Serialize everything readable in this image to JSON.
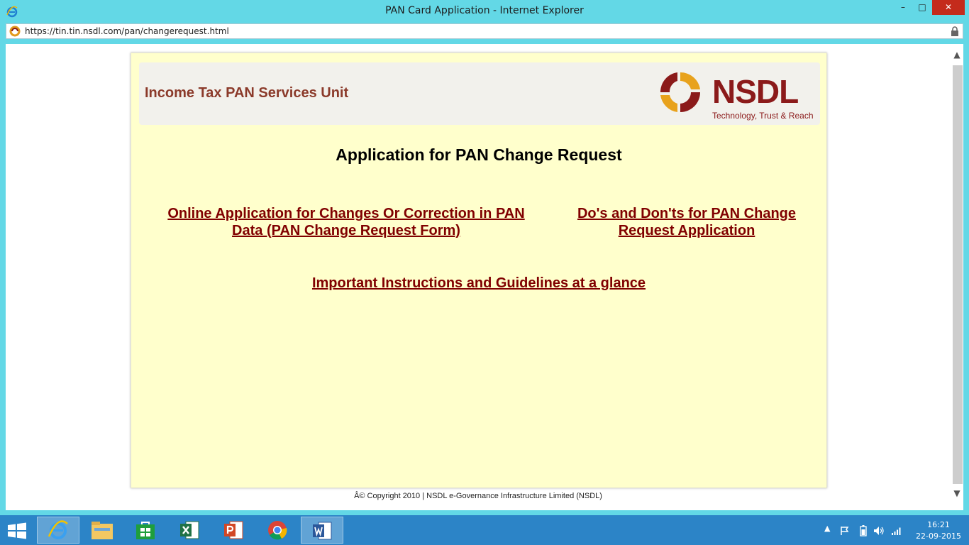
{
  "window": {
    "title": "PAN Card Application - Internet Explorer",
    "minimize_glyph": "–",
    "maximize_glyph": "□",
    "close_glyph": "✕"
  },
  "address": {
    "url": "https://tin.tin.nsdl.com/pan/changerequest.html"
  },
  "header": {
    "unit_title": "Income Tax PAN Services Unit",
    "logo_text": "NSDL",
    "logo_tagline": "Technology, Trust & Reach"
  },
  "main": {
    "heading": "Application for PAN Change Request",
    "links": {
      "online_application": "Online Application for Changes Or Correction in PAN Data (PAN Change Request Form)",
      "dos_donts": "Do's and Don'ts for PAN Change Request Application",
      "instructions": "Important Instructions and Guidelines at a glance"
    }
  },
  "footer": {
    "copyright": "Â© Copyright 2010  |  NSDL e-Governance Infrastructure Limited (NSDL)"
  },
  "taskbar": {
    "apps": [
      "internet-explorer",
      "file-explorer",
      "store",
      "excel",
      "powerpoint",
      "chrome",
      "word"
    ],
    "time": "16:21",
    "date": "22-09-2015"
  },
  "colors": {
    "titlebar": "#63d8e6",
    "page_bg": "#ffffcc",
    "link": "#800000",
    "brand": "#8b1a1a",
    "taskbar": "#2c84c7"
  }
}
